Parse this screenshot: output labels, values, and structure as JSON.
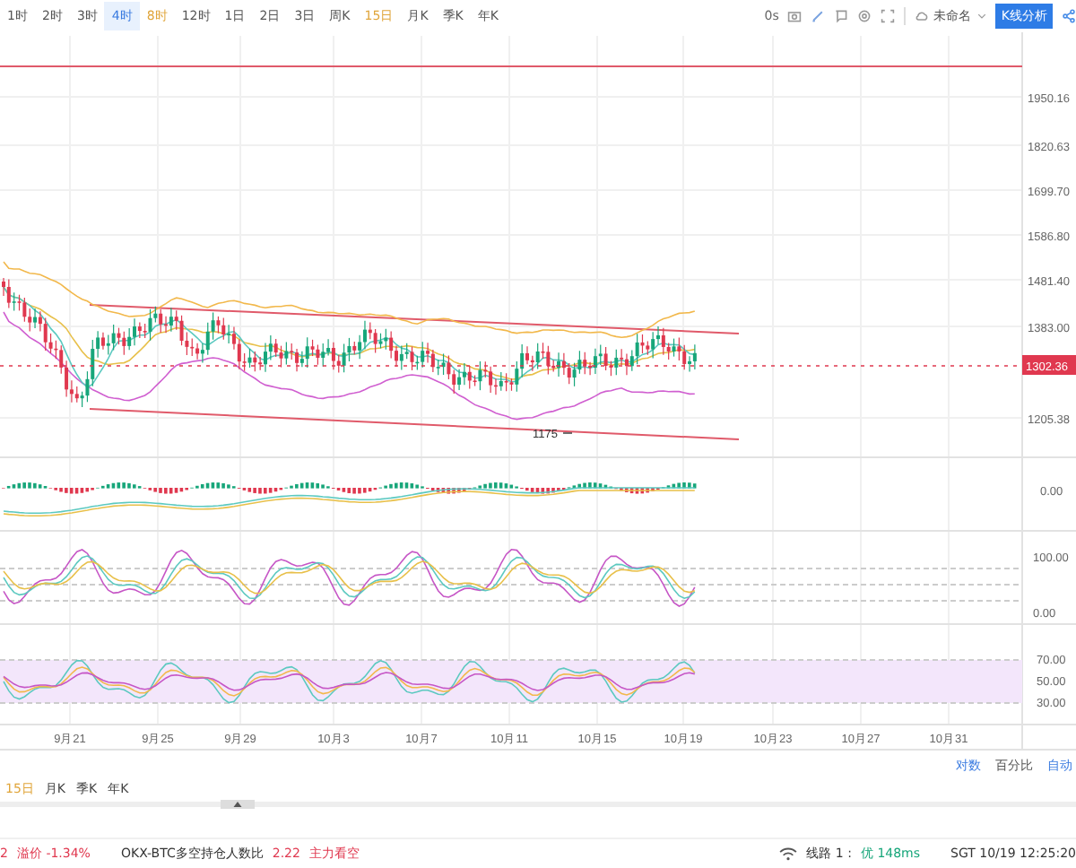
{
  "toolbar": {
    "intervals": [
      {
        "label": "1时",
        "selected": false,
        "highlighted": false
      },
      {
        "label": "2时",
        "selected": false,
        "highlighted": false
      },
      {
        "label": "3时",
        "selected": false,
        "highlighted": false
      },
      {
        "label": "4时",
        "selected": true,
        "highlighted": false
      },
      {
        "label": "8时",
        "selected": false,
        "highlighted": true
      },
      {
        "label": "12时",
        "selected": false,
        "highlighted": false
      },
      {
        "label": "1日",
        "selected": false,
        "highlighted": false
      },
      {
        "label": "2日",
        "selected": false,
        "highlighted": false
      },
      {
        "label": "3日",
        "selected": false,
        "highlighted": false
      },
      {
        "label": "周K",
        "selected": false,
        "highlighted": false
      },
      {
        "label": "15日",
        "selected": false,
        "highlighted": true
      },
      {
        "label": "月K",
        "selected": false,
        "highlighted": false
      },
      {
        "label": "季K",
        "selected": false,
        "highlighted": false
      },
      {
        "label": "年K",
        "selected": false,
        "highlighted": false
      }
    ],
    "countdown": "0s",
    "layout_name": "未命名",
    "analysis_button": "K线分析"
  },
  "chart": {
    "price_ticks": [
      "1950.16",
      "1820.63",
      "1699.70",
      "1586.80",
      "1481.40",
      "1383.00",
      "1205.38"
    ],
    "current_price": "1302.36",
    "low_marker": "1175",
    "macd_ticks": [
      "0.00"
    ],
    "kdj_ticks": [
      "100.00",
      "0.00"
    ],
    "rsi_ticks": [
      "70.00",
      "50.00",
      "30.00"
    ],
    "date_labels": [
      "9月21",
      "9月25",
      "9月29",
      "10月3",
      "10月7",
      "10月11",
      "10月15",
      "10月19",
      "10月23",
      "10月27",
      "10月31"
    ]
  },
  "scale_options": [
    {
      "label": "对数",
      "active": true
    },
    {
      "label": "百分比",
      "active": false
    },
    {
      "label": "自动",
      "active": true
    }
  ],
  "bottom_intervals": [
    {
      "label": "15日",
      "highlighted": true
    },
    {
      "label": "月K",
      "highlighted": false
    },
    {
      "label": "季K",
      "highlighted": false
    },
    {
      "label": "年K",
      "highlighted": false
    }
  ],
  "status_bar": {
    "premium_prefix": "2",
    "premium": "溢价 -1.34%",
    "ratio_label": "OKX-BTC多空持仓人数比",
    "ratio_value": "2.22",
    "sentiment": "主力看空",
    "line_label": "线路 1 :",
    "line_quality": "优 148ms",
    "clock": "SGT  10/19 12:25:20"
  }
}
